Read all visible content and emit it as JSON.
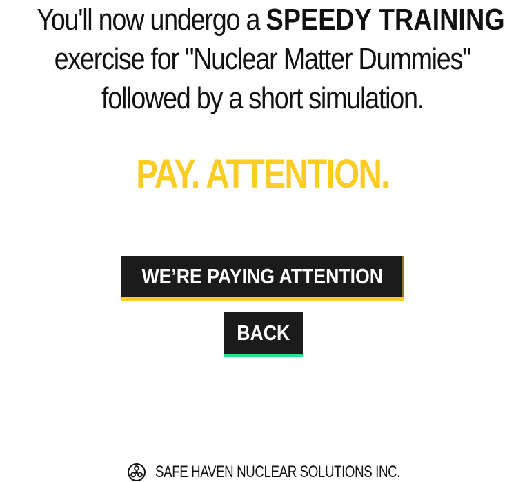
{
  "intro": {
    "line1_pre": "You'll now undergo a",
    "line1_strong": "SPEEDY TRAINING",
    "line2": "exercise for \"Nuclear Matter Dummies\"",
    "line3": "followed by a short simulation."
  },
  "headline": "PAY. ATTENTION.",
  "buttons": {
    "confirm_label": "WE’RE PAYING ATTENTION",
    "back_label": "BACK"
  },
  "footer": {
    "company": "SAFE HAVEN NUCLEAR SOLUTIONS INC.",
    "logo_icon": "nuclear-logo-icon"
  },
  "colors": {
    "accent_yellow": "#fbcd22",
    "accent_green": "#1ee88f",
    "button_bg": "#1b1b1b",
    "text": "#111111"
  }
}
